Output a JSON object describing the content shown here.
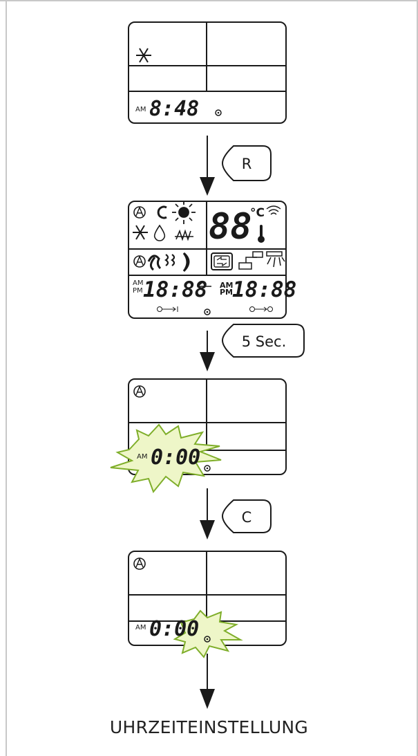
{
  "caption": "UHRZEITEINSTELLUNG",
  "colors": {
    "line": "#1a1a1a",
    "flash_fill": "#eef6c8",
    "flash_stroke": "#7fae2a"
  },
  "steps": [
    {
      "display": {
        "ampm": "AM",
        "time": "8:48"
      },
      "icons": [
        "snowflake-icon"
      ]
    },
    {
      "button": "R"
    },
    {
      "display": {
        "am": "AM",
        "pm": "PM",
        "time_left": "18:88",
        "time_right": "18:88",
        "temp": "88",
        "unit": "°C"
      },
      "icons": [
        "auto-icon",
        "cycle-icon",
        "sun-icon",
        "snowflake-icon",
        "droplet-icon",
        "heat-icon",
        "fan-icon",
        "moon-icon",
        "thermometer-icon",
        "signal-icon",
        "swing-icon",
        "unit-icon",
        "louver-icon"
      ]
    },
    {
      "button": "5 Sec."
    },
    {
      "display": {
        "ampm": "AM",
        "time": "0:00",
        "auto": "A"
      },
      "flash": "time"
    },
    {
      "button": "C"
    },
    {
      "display": {
        "ampm": "AM",
        "time": "0:00",
        "auto": "A"
      },
      "flash": "minutes"
    }
  ]
}
